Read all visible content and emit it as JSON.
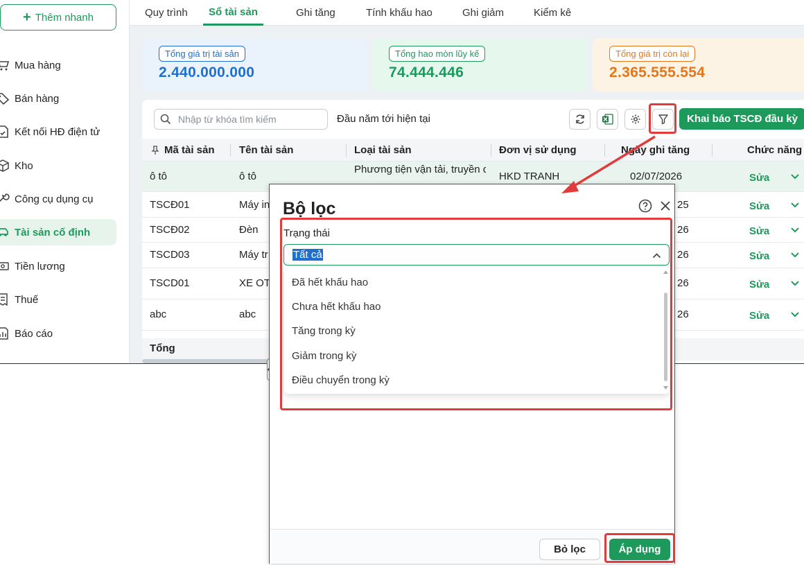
{
  "sidebar": {
    "quick_add": "Thêm nhanh",
    "items": [
      {
        "label": "Mua hàng",
        "icon": "cart-icon"
      },
      {
        "label": "Bán hàng",
        "icon": "tag-icon"
      },
      {
        "label": "Kết nối HĐ điện tử",
        "icon": "e-invoice-icon"
      },
      {
        "label": "Kho",
        "icon": "box-icon"
      },
      {
        "label": "Công cụ dụng cụ",
        "icon": "tools-icon"
      },
      {
        "label": "Tài sản cố định",
        "icon": "car-icon"
      },
      {
        "label": "Tiền lương",
        "icon": "money-icon"
      },
      {
        "label": "Thuế",
        "icon": "receipt-icon"
      },
      {
        "label": "Báo cáo",
        "icon": "report-icon"
      }
    ]
  },
  "tabs": [
    "Quy trình",
    "Sổ tài sản",
    "Ghi tăng",
    "Tính khấu hao",
    "Ghi giảm",
    "Kiểm kê"
  ],
  "summary": [
    {
      "label": "Tổng giá trị tài sản",
      "value": "2.440.000.000",
      "color": "#1f6fd1"
    },
    {
      "label": "Tổng hao mòn lũy kế",
      "value": "74.444.446",
      "color": "#1d9a5b"
    },
    {
      "label": "Tổng giá trị còn lại",
      "value": "2.365.555.554",
      "color": "#e5761a"
    }
  ],
  "toolbar": {
    "search_placeholder": "Nhập từ khóa tìm kiếm",
    "period": "Đầu năm tới hiện tại",
    "declare_button": "Khai báo TSCĐ đầu kỳ"
  },
  "table": {
    "columns": [
      "Mã tài sản",
      "Tên tài sản",
      "Loại tài sản",
      "Đơn vị sử dụng",
      "Ngày ghi tăng",
      "Chức năng"
    ],
    "rows": [
      {
        "code": "ô tô",
        "name": "ô tô",
        "type": "Phương tiện vận tải, truyền dẫ",
        "unit": "HKD TRANH",
        "date": "02/07/2026",
        "action": "Sửa"
      },
      {
        "code": "TSCĐ01",
        "name": "Máy in",
        "type": "",
        "unit": "",
        "date": "25",
        "action": "Sửa"
      },
      {
        "code": "TSCĐ02",
        "name": "Đèn",
        "type": "",
        "unit": "",
        "date": "26",
        "action": "Sửa"
      },
      {
        "code": "TSCD03",
        "name": "Máy tr",
        "type": "",
        "unit": "",
        "date": "26",
        "action": "Sửa"
      },
      {
        "code": "TSCD01",
        "name": "XE OT",
        "type": "",
        "unit": "",
        "date": "26",
        "action": "Sửa"
      },
      {
        "code": "abc",
        "name": "abc",
        "type": "",
        "unit": "",
        "date": "26",
        "action": "Sửa"
      }
    ],
    "total_label": "Tổng"
  },
  "dialog": {
    "title": "Bộ lọc",
    "field_label": "Trạng thái",
    "selected": "Tất cả",
    "options": [
      "Đã hết khấu hao",
      "Chưa hết khấu hao",
      "Tăng trong kỳ",
      "Giảm trong kỳ",
      "Điều chuyển trong kỳ"
    ],
    "clear_button": "Bỏ lọc",
    "apply_button": "Áp dụng"
  }
}
